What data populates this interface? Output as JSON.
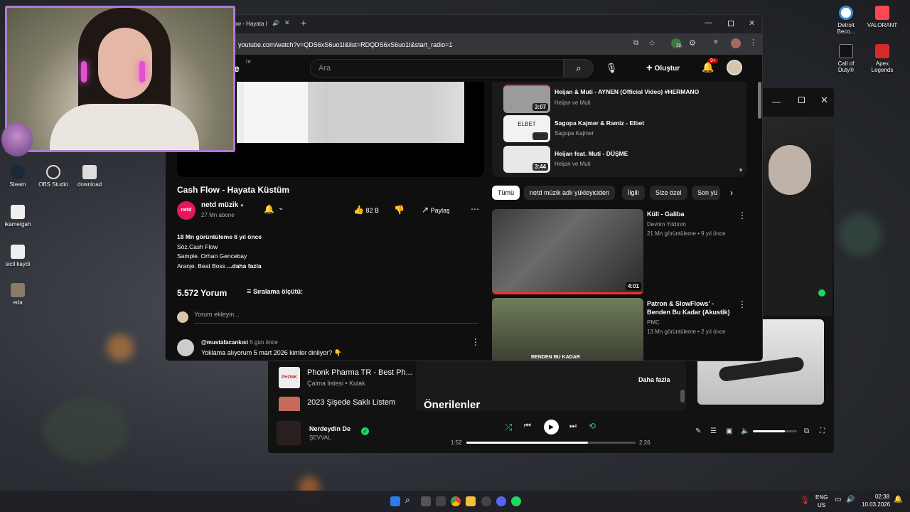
{
  "desktop": {
    "left_icons": [
      "Steam",
      "OBS Studio",
      "download",
      "ikametgah",
      "sicil kaydi",
      "eda"
    ],
    "right_icons": [
      [
        "Detroit",
        "Beco..."
      ],
      [
        "VALORANT"
      ],
      [
        "Call of",
        "Duty®"
      ],
      [
        "Apex",
        "Legends"
      ]
    ]
  },
  "chrome": {
    "tab_title": "low - Hayata I",
    "new_tab": "+",
    "url": "youtube.com/watch?v=QDS6xS6uo1I&list=RDQDS6xS6uo1I&start_radio=1",
    "ext_badge": "29",
    "youtube": {
      "logo_tr": "TR",
      "logo_text": "be",
      "search_placeholder": "Ara",
      "create_label": "Oluştur",
      "notif_count": "9+",
      "video_title": "Cash Flow - Hayata Küstüm",
      "channel": "netd müzik",
      "channel_avatar": "netd",
      "subscribers": "27 Mn abone",
      "likes": "82 B",
      "share": "Paylaş",
      "views_line": "18 Mn görüntüleme  6 yıl önce",
      "desc": [
        "Söz.Cash Flow",
        "Sample. Orhan Gencebay",
        "Aranje. Beat Boss"
      ],
      "more": "...daha fazla",
      "comments_count": "5.572 Yorum",
      "sort": "Sıralama ölçütü:",
      "comment_placeholder": "Yorum ekleyin...",
      "comment": {
        "user": "@mustafacankıst",
        "time": "5 gün önce",
        "text": "Yoklama alıyorum 5 mart 2026 kimler dinliyor? 👇"
      },
      "playlist": [
        {
          "title": "Heijan & Muti - AYNEN (Official Video) #HERMANO",
          "artist": "Heijan ve Muti",
          "dur": "3:07"
        },
        {
          "title": "Sagopa Kajmer & Ramiz - Elbet",
          "artist": "Sagopa Kajmer",
          "dur": "3:35",
          "thumb_text": "ELBET"
        },
        {
          "title": "Heijan feat. Muti - DÜŞME",
          "artist": "Heijan ve Muti",
          "dur": "3:44"
        }
      ],
      "chips": [
        "Tümü",
        "netd müzik adlı yükleyiciden",
        "İlgili",
        "Size özel",
        "Son yü"
      ],
      "recs": [
        {
          "title": "Küll - Galiba",
          "channel": "Devrim Yıldırım",
          "meta": "21 Mn görüntüleme • 9 yıl önce",
          "dur": "4:01"
        },
        {
          "title": "Patron & SlowFlows' - Benden Bu Kadar (Akustik)",
          "channel": "PMC",
          "meta": "13 Mn görüntüleme • 2 yıl önce",
          "thumb_text": "BENDEN BU KADAR"
        }
      ]
    }
  },
  "spotify": {
    "lib": [
      {
        "title": "Phonk Pharma TR - Best Ph...",
        "sub": "Çalma listesi • Kulak",
        "thumb_text": "PHONK PHARMA"
      },
      {
        "title": "2023 Şişede Saklı Listem",
        "sub": ""
      }
    ],
    "more": "Daha fazla",
    "recommended": "Önerilenler",
    "track": "Nerdeydin De",
    "artist": "ŞEVVAL",
    "elapsed": "1:52",
    "total": "2:26",
    "progress": 0.72,
    "volume": 0.72
  },
  "taskbar": {
    "lang": "ENG",
    "region": "US",
    "time": "02:38",
    "date": "10.03.2026"
  }
}
